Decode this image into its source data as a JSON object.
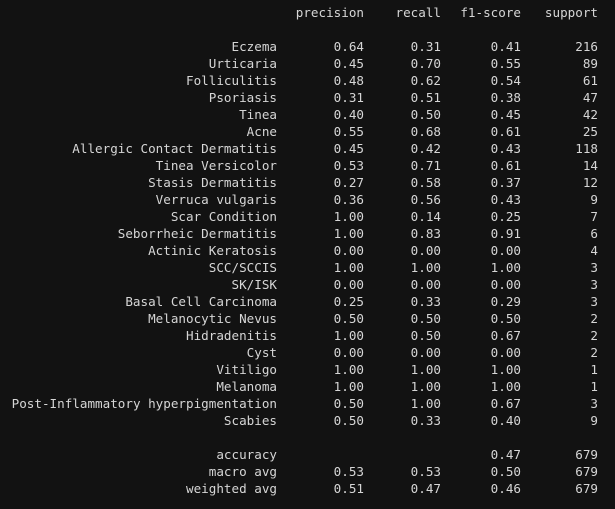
{
  "report": {
    "headers": {
      "precision": "precision",
      "recall": "recall",
      "f1": "f1-score",
      "support": "support"
    },
    "rows": [
      {
        "label": "Eczema",
        "precision": "0.64",
        "recall": "0.31",
        "f1": "0.41",
        "support": "216"
      },
      {
        "label": "Urticaria",
        "precision": "0.45",
        "recall": "0.70",
        "f1": "0.55",
        "support": "89"
      },
      {
        "label": "Folliculitis",
        "precision": "0.48",
        "recall": "0.62",
        "f1": "0.54",
        "support": "61"
      },
      {
        "label": "Psoriasis",
        "precision": "0.31",
        "recall": "0.51",
        "f1": "0.38",
        "support": "47"
      },
      {
        "label": "Tinea",
        "precision": "0.40",
        "recall": "0.50",
        "f1": "0.45",
        "support": "42"
      },
      {
        "label": "Acne",
        "precision": "0.55",
        "recall": "0.68",
        "f1": "0.61",
        "support": "25"
      },
      {
        "label": "Allergic Contact Dermatitis",
        "precision": "0.45",
        "recall": "0.42",
        "f1": "0.43",
        "support": "118"
      },
      {
        "label": "Tinea Versicolor",
        "precision": "0.53",
        "recall": "0.71",
        "f1": "0.61",
        "support": "14"
      },
      {
        "label": "Stasis Dermatitis",
        "precision": "0.27",
        "recall": "0.58",
        "f1": "0.37",
        "support": "12"
      },
      {
        "label": "Verruca vulgaris",
        "precision": "0.36",
        "recall": "0.56",
        "f1": "0.43",
        "support": "9"
      },
      {
        "label": "Scar Condition",
        "precision": "1.00",
        "recall": "0.14",
        "f1": "0.25",
        "support": "7"
      },
      {
        "label": "Seborrheic Dermatitis",
        "precision": "1.00",
        "recall": "0.83",
        "f1": "0.91",
        "support": "6"
      },
      {
        "label": "Actinic Keratosis",
        "precision": "0.00",
        "recall": "0.00",
        "f1": "0.00",
        "support": "4"
      },
      {
        "label": "SCC/SCCIS",
        "precision": "1.00",
        "recall": "1.00",
        "f1": "1.00",
        "support": "3"
      },
      {
        "label": "SK/ISK",
        "precision": "0.00",
        "recall": "0.00",
        "f1": "0.00",
        "support": "3"
      },
      {
        "label": "Basal Cell Carcinoma",
        "precision": "0.25",
        "recall": "0.33",
        "f1": "0.29",
        "support": "3"
      },
      {
        "label": "Melanocytic Nevus",
        "precision": "0.50",
        "recall": "0.50",
        "f1": "0.50",
        "support": "2"
      },
      {
        "label": "Hidradenitis",
        "precision": "1.00",
        "recall": "0.50",
        "f1": "0.67",
        "support": "2"
      },
      {
        "label": "Cyst",
        "precision": "0.00",
        "recall": "0.00",
        "f1": "0.00",
        "support": "2"
      },
      {
        "label": "Vitiligo",
        "precision": "1.00",
        "recall": "1.00",
        "f1": "1.00",
        "support": "1"
      },
      {
        "label": "Melanoma",
        "precision": "1.00",
        "recall": "1.00",
        "f1": "1.00",
        "support": "1"
      },
      {
        "label": "Post-Inflammatory hyperpigmentation",
        "precision": "0.50",
        "recall": "1.00",
        "f1": "0.67",
        "support": "3"
      },
      {
        "label": "Scabies",
        "precision": "0.50",
        "recall": "0.33",
        "f1": "0.40",
        "support": "9"
      }
    ],
    "summary": [
      {
        "label": "accuracy",
        "precision": "",
        "recall": "",
        "f1": "0.47",
        "support": "679"
      },
      {
        "label": "macro avg",
        "precision": "0.53",
        "recall": "0.53",
        "f1": "0.50",
        "support": "679"
      },
      {
        "label": "weighted avg",
        "precision": "0.51",
        "recall": "0.47",
        "f1": "0.46",
        "support": "679"
      }
    ]
  },
  "colors": {
    "background": "#121212",
    "text": "#d6d6d6"
  }
}
